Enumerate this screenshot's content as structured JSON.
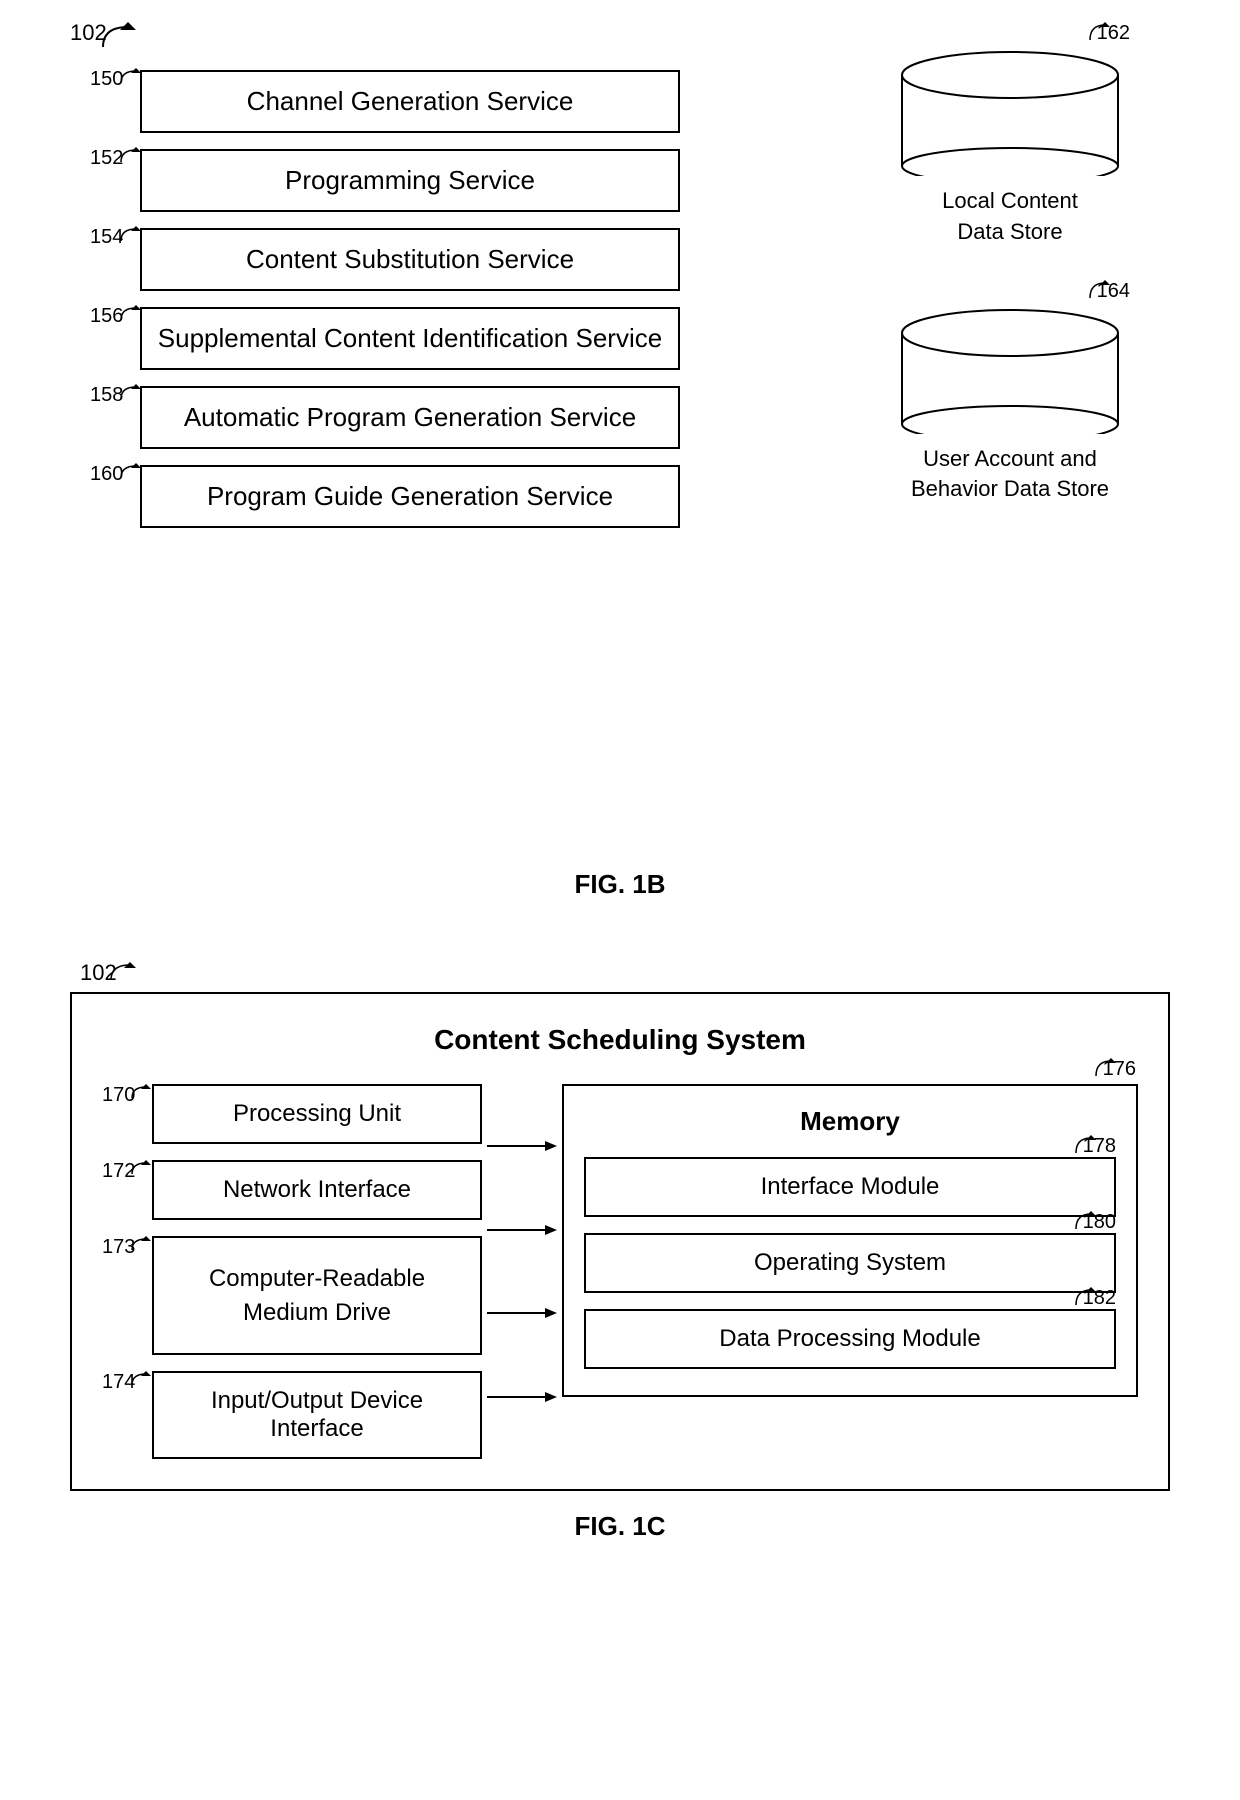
{
  "fig1b": {
    "ref_main": "102",
    "ref_arrow": "↗",
    "left_col_label": "150",
    "services": [
      {
        "ref": "150",
        "label": "Channel Generation Service"
      },
      {
        "ref": "152",
        "label": "Programming Service"
      },
      {
        "ref": "154",
        "label": "Content Substitution Service"
      },
      {
        "ref": "156",
        "label": "Supplemental Content Identification Service"
      },
      {
        "ref": "158",
        "label": "Automatic Program Generation Service"
      },
      {
        "ref": "160",
        "label": "Program Guide Generation Service"
      }
    ],
    "datastores": [
      {
        "ref": "162",
        "label": "Local Content\nData Store"
      },
      {
        "ref": "164",
        "label": "User Account and\nBehavior Data Store"
      }
    ],
    "caption": "FIG. 1B"
  },
  "fig1c": {
    "ref": "102",
    "outer_title": "Content Scheduling System",
    "caption": "FIG. 1C",
    "left_units": [
      {
        "ref": "170",
        "label": "Processing Unit"
      },
      {
        "ref": "172",
        "label": "Network Interface"
      },
      {
        "ref": "173",
        "label": "Computer-Readable\nMedium Drive"
      },
      {
        "ref": "174",
        "label": "Input/Output Device Interface"
      }
    ],
    "memory": {
      "ref": "176",
      "title": "Memory",
      "modules": [
        {
          "ref": "178",
          "label": "Interface Module"
        },
        {
          "ref": "180",
          "label": "Operating System"
        },
        {
          "ref": "182",
          "label": "Data Processing Module"
        }
      ]
    }
  }
}
